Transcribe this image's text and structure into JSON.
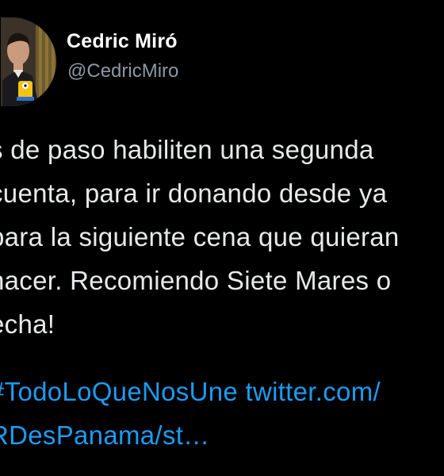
{
  "author": {
    "name": "Cedric Miró",
    "handle": "@CedricMiro"
  },
  "tweet": {
    "lines": [
      "s de paso habiliten una segunda",
      "cuenta, para ir donando desde ya",
      "para la siguiente cena que quieran",
      "hacer. Recomiendo Siete Mares o",
      "echa!"
    ],
    "hashtag": "#TodoLoQueNosUne",
    "link_part1": "twitter.com/",
    "link_part2": "RDesPanama/st…"
  },
  "colors": {
    "background": "#000000",
    "text": "#e7e9ea",
    "secondary": "#8b98a5",
    "link": "#1d9bf0"
  }
}
